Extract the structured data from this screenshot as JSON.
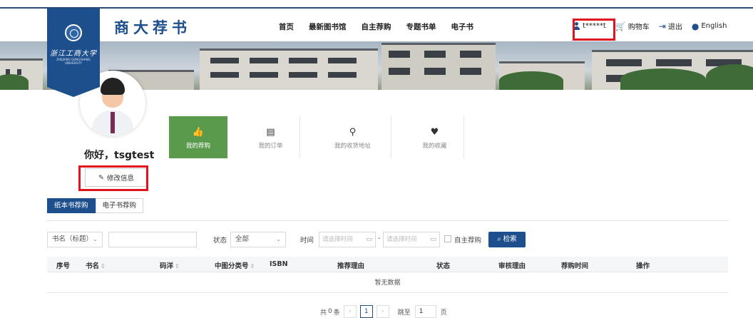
{
  "header": {
    "brand": "商大荐书",
    "logo_cn": "浙江工商大学",
    "logo_en": "ZHEJIANG GONGSHANG UNIVERSITY",
    "nav": [
      "首页",
      "最新图书馆",
      "自主荐购",
      "专题书单",
      "电子书"
    ],
    "user_name": "t*****t",
    "cart": "购物车",
    "logout": "退出",
    "language": "English"
  },
  "profile": {
    "greeting": "你好，tsgtest",
    "edit_label": "修改信息"
  },
  "tiles": [
    {
      "label": "我的荐购",
      "icon": "thumbs-up-icon"
    },
    {
      "label": "我的订单",
      "icon": "order-list-icon"
    },
    {
      "label": "我的收货地址",
      "icon": "location-pin-icon"
    },
    {
      "label": "我的收藏",
      "icon": "heart-icon"
    }
  ],
  "tabs": [
    "纸本书荐购",
    "电子书荐购"
  ],
  "filters": {
    "field_select": "书名（标题）",
    "status_label": "状态",
    "status_value": "全部",
    "time_label": "时间",
    "date_placeholder": "请选择时间",
    "date_separator": "-",
    "self_recommend": "自主荐购",
    "search_button": "检索"
  },
  "table": {
    "columns": [
      "序号",
      "书名",
      "码洋",
      "中图分类号",
      "ISBN",
      "推荐理由",
      "状态",
      "审核理由",
      "荐购时间",
      "操作"
    ],
    "empty_text": "暂无数据"
  },
  "pager": {
    "total_prefix": "共",
    "total_count": "0",
    "total_suffix": "条",
    "current_page": "1",
    "jump_label": "跳至",
    "jump_value": "1",
    "page_suffix": "页"
  },
  "colors": {
    "primary": "#1d4f8d",
    "tile_active": "#5a9a4d",
    "highlight": "#e0141e"
  }
}
